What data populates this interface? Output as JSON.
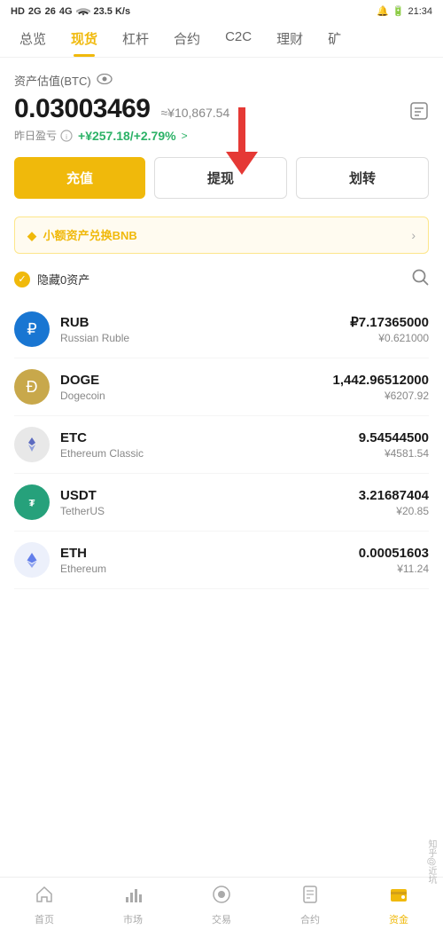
{
  "statusBar": {
    "left": "HD 2G 26 4G",
    "network": "23.5 K/s",
    "time": "21:34",
    "battery": "20"
  },
  "navTabs": {
    "items": [
      {
        "label": "总览",
        "active": false
      },
      {
        "label": "现货",
        "active": true
      },
      {
        "label": "杠杆",
        "active": false
      },
      {
        "label": "合约",
        "active": false
      },
      {
        "label": "C2C",
        "active": false
      },
      {
        "label": "理财",
        "active": false
      },
      {
        "label": "矿",
        "active": false
      }
    ]
  },
  "portfolio": {
    "assetLabel": "资产估值(BTC)",
    "btcValue": "0.03003469",
    "cnyApprox": "≈¥10,867.54",
    "pnlLabel": "昨日盈亏",
    "pnlValue": "+¥257.18/+2.79%",
    "pnlArrow": ">"
  },
  "buttons": {
    "charge": "充值",
    "withdraw": "提现",
    "transfer": "划转"
  },
  "banner": {
    "text": "小额资产兑换BNB",
    "arrow": "›"
  },
  "filter": {
    "label": "隐藏0资产"
  },
  "assets": [
    {
      "symbol": "RUB",
      "name": "Russian Ruble",
      "iconType": "rub",
      "iconChar": "₽",
      "amount": "₽7.17365000",
      "cnyValue": "¥0.621000"
    },
    {
      "symbol": "DOGE",
      "name": "Dogecoin",
      "iconType": "doge",
      "iconChar": "Ð",
      "amount": "1,442.96512000",
      "cnyValue": "¥6207.92"
    },
    {
      "symbol": "ETC",
      "name": "Ethereum Classic",
      "iconType": "etc",
      "iconChar": "◆",
      "amount": "9.54544500",
      "cnyValue": "¥4581.54"
    },
    {
      "symbol": "USDT",
      "name": "TetherUS",
      "iconType": "usdt",
      "iconChar": "₮",
      "amount": "3.21687404",
      "cnyValue": "¥20.85"
    },
    {
      "symbol": "ETH",
      "name": "Ethereum",
      "iconType": "eth",
      "iconChar": "Ξ",
      "amount": "0.00051603",
      "cnyValue": "¥11.24"
    }
  ],
  "bottomNav": {
    "items": [
      {
        "label": "首页",
        "active": false,
        "icon": "⌂"
      },
      {
        "label": "市场",
        "active": false,
        "icon": "╫"
      },
      {
        "label": "交易",
        "active": false,
        "icon": "⊙"
      },
      {
        "label": "合约",
        "active": false,
        "icon": "📄"
      },
      {
        "label": "资金",
        "active": true,
        "icon": "💰"
      }
    ]
  },
  "watermark": "知乎@近坑"
}
